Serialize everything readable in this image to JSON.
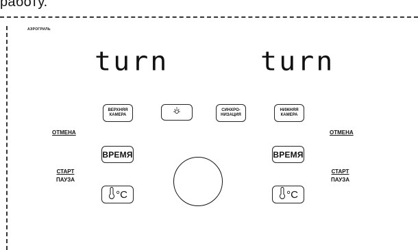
{
  "page": {
    "top_text": "работу."
  },
  "panel": {
    "brand": "АЭРОГРИЛЬ",
    "left_display": "turn",
    "right_display": "turn"
  },
  "buttons": {
    "upper_chamber": [
      "ВЕРХНЯЯ",
      "КАМЕРА"
    ],
    "lower_chamber": [
      "НИЖНЯЯ",
      "КАМЕРА"
    ],
    "sync": [
      "СИНХРО-",
      "НИЗАЦИЯ"
    ],
    "time_left": "ВРЕМЯ",
    "time_right": "ВРЕМЯ",
    "temp_left": "°C",
    "temp_right": "°C",
    "lamp_icon": "lamp-icon",
    "thermometer_icon": "thermometer-icon"
  },
  "labels": {
    "cancel_left": "ОТМЕНА",
    "cancel_right": "ОТМЕНА",
    "start_left": "СТАРТ",
    "pause_left": "ПАУЗА",
    "start_right": "СТАРТ",
    "pause_right": "ПАУЗА"
  }
}
